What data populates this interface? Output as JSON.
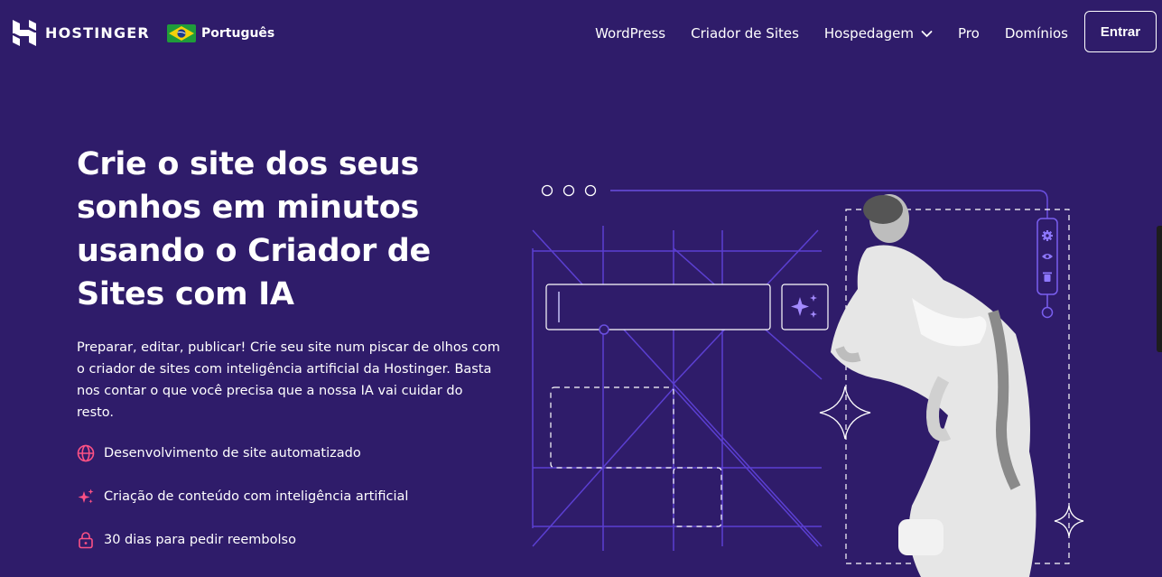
{
  "header": {
    "brand": "HOSTINGER",
    "language": "Português",
    "nav": [
      "WordPress",
      "Criador de Sites",
      "Hospedagem",
      "Pro",
      "Domínios"
    ],
    "login_label": "Entrar"
  },
  "hero": {
    "title": "Crie o site dos seus sonhos em minutos usando o Criador de Sites com IA",
    "description": "Preparar, editar, publicar! Crie seu site num piscar de olhos com o criador de sites com inteligência artificial da Hostinger. Basta nos contar o que você precisa que a nossa IA vai cuidar do resto.",
    "features": [
      {
        "icon": "globe-icon",
        "text": "Desenvolvimento de site automatizado"
      },
      {
        "icon": "sparkles-icon",
        "text": "Criação de conteúdo com inteligência artificial"
      },
      {
        "icon": "lock-icon",
        "text": "30 dias para pedir reembolso"
      }
    ]
  },
  "colors": {
    "background": "#2f1c6a",
    "grid_line": "#5b3fd1",
    "accent_pink": "#fc5185",
    "text": "#ffffff"
  },
  "illustration": {
    "toolbar_icons": [
      "gear-icon",
      "eye-icon",
      "trash-icon"
    ],
    "prompt_input_value": "",
    "generate_icon": "sparkles-icon"
  }
}
